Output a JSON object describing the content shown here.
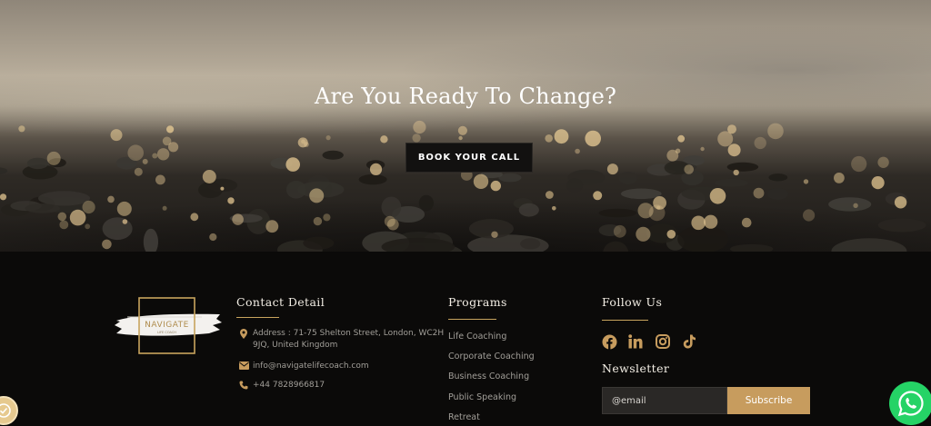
{
  "hero": {
    "title": "Are You Ready To Change?",
    "cta_label": "BOOK YOUR CALL"
  },
  "logo": {
    "text_line1": "NAVIGATE",
    "text_line2": "LIFE COACH"
  },
  "contact": {
    "title": "Contact Detail",
    "address_line1": "Address : 71-75 Shelton Street, London, WC2H",
    "address_line2": "9JQ, United Kingdom",
    "email": "info@navigatelifecoach.com",
    "phone": "+44 7828966817",
    "icon_names": [
      "location-pin-icon",
      "envelope-icon",
      "phone-icon"
    ]
  },
  "programs": {
    "title": "Programs",
    "items": [
      "Life Coaching",
      "Corporate Coaching",
      "Business Coaching",
      "Public Speaking",
      "Retreat"
    ]
  },
  "follow": {
    "title": "Follow Us",
    "social": [
      "facebook-icon",
      "linkedin-icon",
      "instagram-icon",
      "tiktok-icon"
    ]
  },
  "newsletter": {
    "title": "Newsletter",
    "email_placeholder": "@email",
    "subscribe_label": "Subscribe"
  },
  "colors": {
    "accent": "#c79c5e",
    "footer_bg": "#0b0a09",
    "whatsapp": "#25d366"
  }
}
